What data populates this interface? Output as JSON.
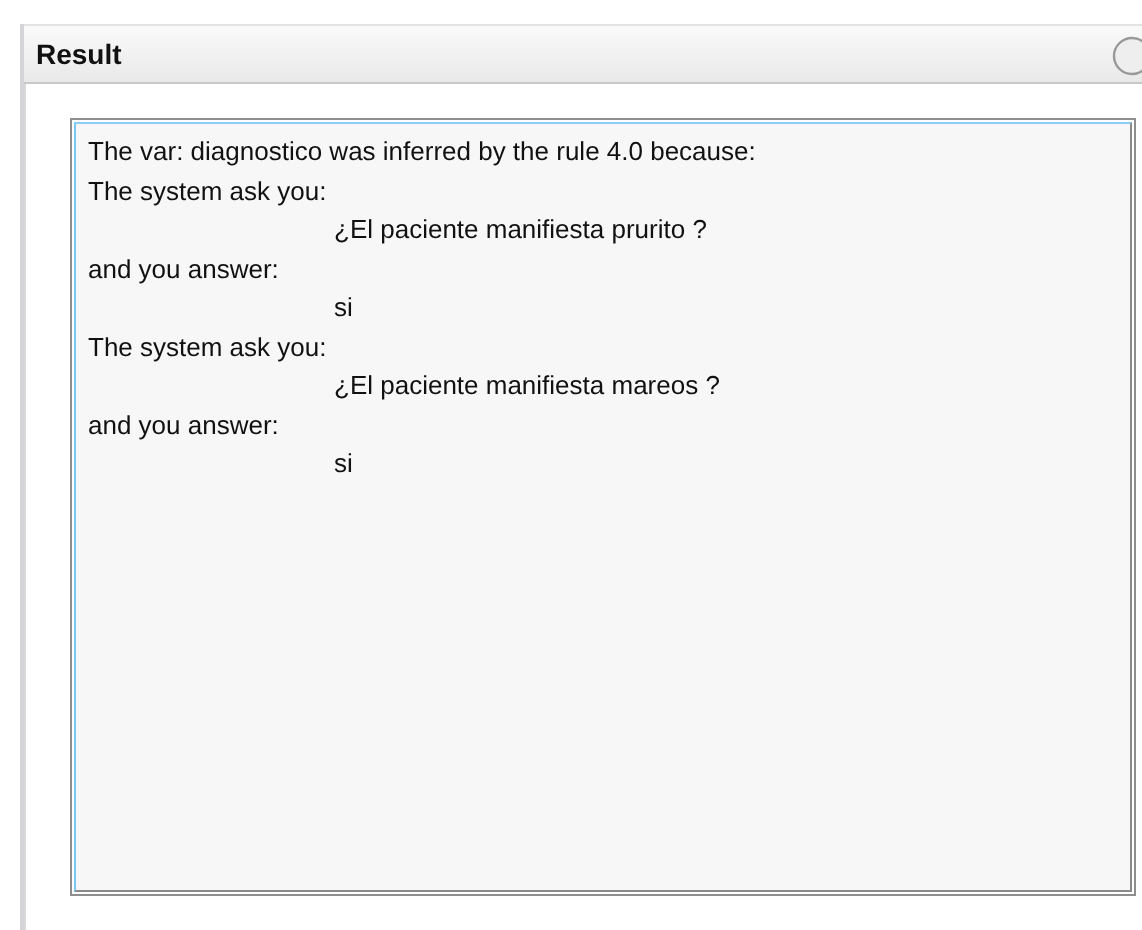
{
  "panel": {
    "title": "Result",
    "lines": [
      {
        "kind": "plain",
        "text": "The var: diagnostico was inferred by the rule 4.0 because:"
      },
      {
        "kind": "plain",
        "text": "The system ask you:"
      },
      {
        "kind": "indent",
        "text": "¿El paciente manifiesta prurito ?"
      },
      {
        "kind": "plain",
        "text": "and you answer:"
      },
      {
        "kind": "indent",
        "text": "si"
      },
      {
        "kind": "plain",
        "text": "The system ask you:"
      },
      {
        "kind": "indent",
        "text": "¿El paciente manifiesta mareos ?"
      },
      {
        "kind": "plain",
        "text": "and you answer:"
      },
      {
        "kind": "indent",
        "text": "si"
      }
    ]
  }
}
